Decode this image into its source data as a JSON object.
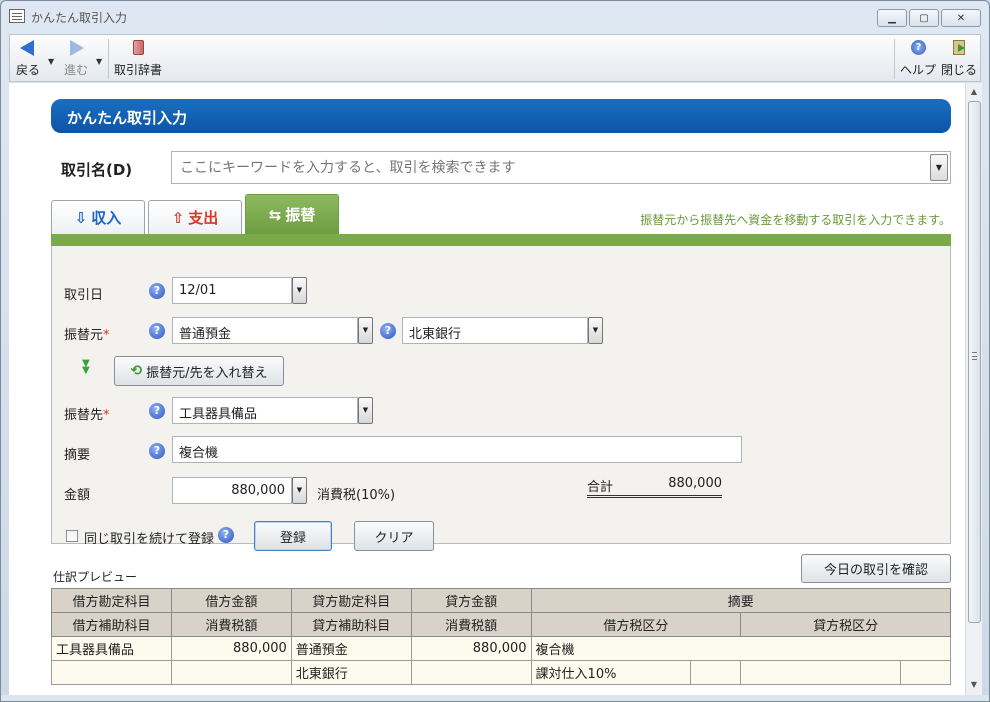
{
  "window": {
    "title": "かんたん取引入力"
  },
  "toolbar": {
    "back_label": "戻る",
    "forward_label": "進む",
    "dictionary_label": "取引辞書",
    "help_label": "ヘルプ",
    "close_label": "閉じる"
  },
  "header": {
    "title": "かんたん取引入力"
  },
  "transaction_name": {
    "label": "取引名(D)",
    "placeholder": "ここにキーワードを入力すると、取引を検索できます"
  },
  "tabs": [
    {
      "label": "収入",
      "icon": "income-icon"
    },
    {
      "label": "支出",
      "icon": "expense-icon"
    },
    {
      "label": "振替",
      "icon": "transfer-icon",
      "active": true
    }
  ],
  "tab_hint": "振替元から振替先へ資金を移動する取引を入力できます。",
  "form": {
    "date_label": "取引日",
    "date_value": "12/01",
    "from_label": "振替元",
    "required_mark": "*",
    "from_account": "普通預金",
    "from_sub_account": "北東銀行",
    "swap_button": "振替元/先を入れ替え",
    "to_label": "振替先",
    "to_account": "工具器具備品",
    "memo_label": "摘要",
    "memo_value": "複合機",
    "amount_label": "金額",
    "amount_value": "880,000",
    "tax_label": "消費税(10%)",
    "total_label": "合計",
    "total_value": "880,000",
    "repeat_label": "同じ取引を続けて登録",
    "register_button": "登録",
    "clear_button": "クリア"
  },
  "preview": {
    "label": "仕訳プレビュー",
    "confirm_button": "今日の取引を確認",
    "header_row1": [
      "借方勘定科目",
      "借方金額",
      "貸方勘定科目",
      "貸方金額",
      "摘要"
    ],
    "header_row2": [
      "借方補助科目",
      "消費税額",
      "貸方補助科目",
      "消費税額",
      "借方税区分",
      "貸方税区分"
    ],
    "row1": [
      "工具器具備品",
      "880,000",
      "普通預金",
      "880,000",
      "複合機"
    ],
    "row2": [
      "",
      "",
      "北東銀行",
      "",
      "課対仕入10%",
      "",
      "",
      ""
    ]
  },
  "colors": {
    "banner": "#0c55a8",
    "transfer_tab": "#7aaa4a",
    "income": "#1b64c8",
    "expense": "#d43a2a",
    "hint": "#6a9a3a"
  }
}
